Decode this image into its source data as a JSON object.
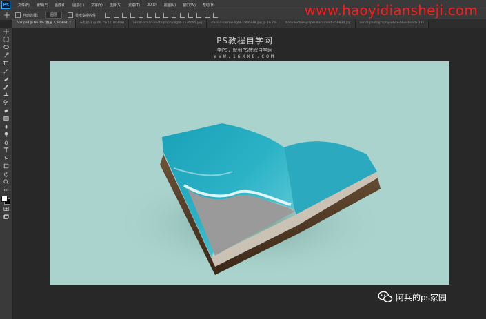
{
  "app": {
    "logo": "Ps"
  },
  "menu": [
    "文件(F)",
    "编辑(E)",
    "图像(I)",
    "图层(L)",
    "文字(Y)",
    "选择(S)",
    "滤镜(T)",
    "3D(D)",
    "视图(V)",
    "窗口(W)",
    "帮助(H)"
  ],
  "options_bar": {
    "auto_select_label": "自动选择：",
    "auto_select_value": "图层",
    "show_transform_label": "显示变换控件"
  },
  "tabs": [
    {
      "label": "502.psd @ 66.7% (图层 2, RGB/8) *"
    },
    {
      "label": "未标题-1 @ 66.7% (2, RGB/8)"
    },
    {
      "label": "aerial-ocean-photography-light-1576695.jpg"
    },
    {
      "label": "classic-narrow-light-1906338.jpg @ 16.7%"
    },
    {
      "label": "book-lecture-paper-document-459834.jpg"
    },
    {
      "label": "aerial-photography-white-blue-beach-181"
    }
  ],
  "tools": [
    "move-icon",
    "marquee-icon",
    "lasso-icon",
    "quick-select-icon",
    "crop-icon",
    "eyedropper-icon",
    "healing-icon",
    "brush-icon",
    "stamp-icon",
    "history-brush-icon",
    "eraser-icon",
    "gradient-icon",
    "blur-icon",
    "dodge-icon",
    "pen-icon",
    "type-icon",
    "path-select-icon",
    "shape-icon",
    "hand-icon",
    "zoom-icon",
    "more-icon"
  ],
  "colors": {
    "foreground": "#ffffff",
    "background": "#000000",
    "canvas": "#a9d3cc",
    "watermark": "#ff1a1a"
  },
  "watermark": {
    "url": "www.haoyidiansheji.com",
    "ps_title": "PS教程自学网",
    "ps_subtitle": "学PS，就到PS教程自学网",
    "ps_url": "WWW.16XX8.COM",
    "wechat_account": "阿兵的ps家园"
  }
}
